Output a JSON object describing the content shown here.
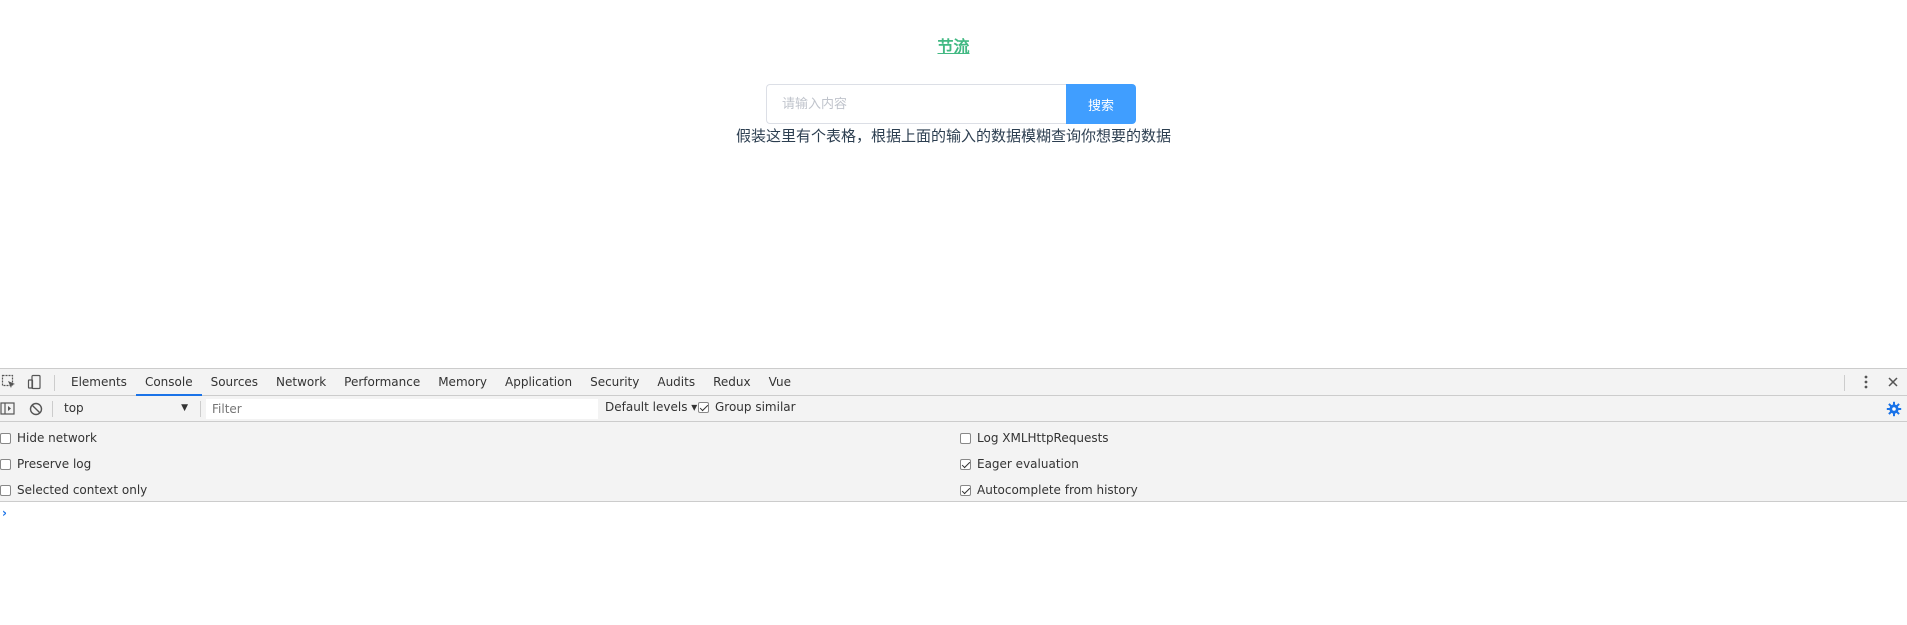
{
  "page": {
    "link_text": "节流",
    "search_placeholder": "请输入内容",
    "search_button": "搜索",
    "description": "假装这里有个表格，根据上面的输入的数据模糊查询你想要的数据"
  },
  "devtools": {
    "tabs": [
      "Elements",
      "Console",
      "Sources",
      "Network",
      "Performance",
      "Memory",
      "Application",
      "Security",
      "Audits",
      "Redux",
      "Vue"
    ],
    "active_tab": "Console",
    "toolbar": {
      "context": "top",
      "filter_placeholder": "Filter",
      "levels": "Default levels ▾",
      "group_similar": "Group similar",
      "group_similar_checked": true
    },
    "settings_left": [
      {
        "label": "Hide network",
        "checked": false
      },
      {
        "label": "Preserve log",
        "checked": false
      },
      {
        "label": "Selected context only",
        "checked": false
      }
    ],
    "settings_right": [
      {
        "label": "Log XMLHttpRequests",
        "checked": false
      },
      {
        "label": "Eager evaluation",
        "checked": true
      },
      {
        "label": "Autocomplete from history",
        "checked": true
      }
    ],
    "prompt": "›",
    "colors": {
      "accent": "#1a73e8",
      "link": "#42b983",
      "button": "#409eff"
    },
    "icons": [
      "inspect-element-icon",
      "device-toolbar-icon",
      "more-options-icon",
      "close-icon",
      "sidebar-toggle-icon",
      "clear-console-icon",
      "settings-gear-icon"
    ]
  }
}
